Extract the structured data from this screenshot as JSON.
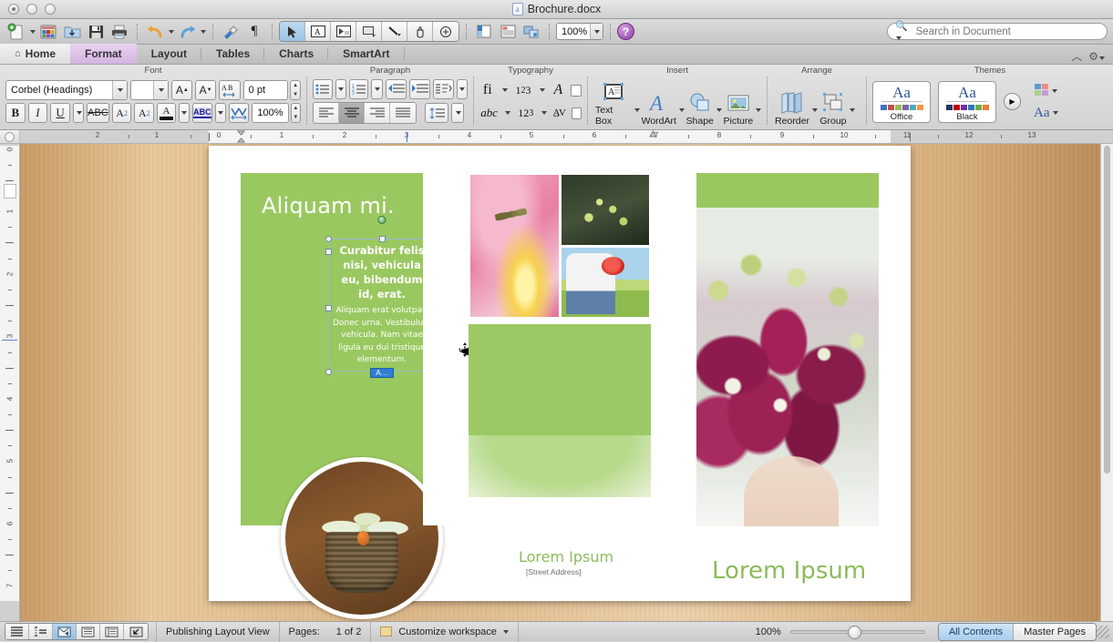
{
  "window": {
    "title": "Brochure.docx",
    "controls": [
      "close",
      "minimize",
      "zoom"
    ]
  },
  "toolbar": {
    "buttons": [
      {
        "name": "new-document",
        "icon": "new-doc-icon"
      },
      {
        "name": "open-template-gallery",
        "icon": "gallery-icon"
      },
      {
        "name": "open",
        "icon": "open-folder-icon"
      },
      {
        "name": "save",
        "icon": "floppy-icon"
      },
      {
        "name": "print",
        "icon": "printer-icon"
      },
      {
        "name": "undo",
        "icon": "undo-arrow-icon"
      },
      {
        "name": "redo",
        "icon": "redo-arrow-icon"
      },
      {
        "name": "format-painter",
        "icon": "paintbrush-icon"
      },
      {
        "name": "show-hide-marks",
        "icon": "pilcrow-icon"
      }
    ],
    "object_tools": [
      {
        "name": "select-arrow",
        "icon": "arrow-pointer-icon",
        "active": true
      },
      {
        "name": "text-box-tool",
        "icon": "textbox-icon",
        "active": false
      },
      {
        "name": "linked-text-tool",
        "icon": "linked-textbox-icon",
        "active": false
      },
      {
        "name": "shape-tool",
        "icon": "rectangle-icon",
        "active": false
      },
      {
        "name": "line-tool",
        "icon": "line-icon",
        "active": false
      },
      {
        "name": "pan-tool",
        "icon": "hand-icon",
        "active": false
      },
      {
        "name": "masking-tool",
        "icon": "mask-icon",
        "active": false
      }
    ],
    "panes": [
      {
        "name": "sidebar-pane",
        "icon": "sidebar-icon"
      },
      {
        "name": "notebook-pane",
        "icon": "notebook-icon"
      },
      {
        "name": "media-browser",
        "icon": "media-icon"
      }
    ],
    "zoom_value": "100%",
    "help_label": "?",
    "search": {
      "placeholder": "Search in Document",
      "value": "",
      "icon": "magnifier-icon"
    }
  },
  "tabs": {
    "items": [
      {
        "label": "Home",
        "icon": "home-icon",
        "active": false
      },
      {
        "label": "Format",
        "icon": "",
        "active": true
      },
      {
        "label": "Layout",
        "icon": "",
        "active": false
      },
      {
        "label": "Tables",
        "icon": "",
        "active": false
      },
      {
        "label": "Charts",
        "icon": "",
        "active": false
      },
      {
        "label": "SmartArt",
        "icon": "",
        "active": false
      }
    ],
    "collapse_icon": "chevron-up-icon",
    "settings_icon": "gear-icon"
  },
  "ribbon": {
    "groups": [
      {
        "title": "Font",
        "font_name": "Corbel (Headings)",
        "font_size": "",
        "character_spacing": "0 pt",
        "scale": "100%",
        "buttons": [
          "grow-font",
          "shrink-font",
          "character-spacing",
          "bold",
          "italic",
          "underline",
          "strikethrough",
          "superscript",
          "subscript",
          "font-color",
          "highlight",
          "horizontal-scale"
        ]
      },
      {
        "title": "Paragraph",
        "buttons": [
          "bulleted-list",
          "numbered-list",
          "decrease-indent",
          "increase-indent",
          "sort",
          "align-left",
          "align-center",
          "align-right",
          "justify",
          "line-spacing"
        ]
      },
      {
        "title": "Typography",
        "buttons": [
          "ligatures",
          "number-spacing",
          "stylistic-sets",
          "stylistic-alternates",
          "number-forms",
          "kerning"
        ]
      },
      {
        "title": "Insert",
        "items": [
          {
            "label": "Text Box",
            "icon": "textbox-icon"
          },
          {
            "label": "WordArt",
            "icon": "wordart-icon"
          },
          {
            "label": "Shape",
            "icon": "shape-icon"
          },
          {
            "label": "Picture",
            "icon": "picture-icon"
          }
        ]
      },
      {
        "title": "Arrange",
        "items": [
          {
            "label": "Reorder",
            "icon": "reorder-icon"
          },
          {
            "label": "Group",
            "icon": "group-icon"
          }
        ]
      },
      {
        "title": "Themes",
        "items": [
          {
            "label": "Office",
            "icon": "theme-thumbnail"
          },
          {
            "label": "Black",
            "icon": "theme-thumbnail"
          }
        ],
        "more_icon": "more-themes-icon",
        "colors_icon": "theme-colors-icon",
        "fonts_label": "Aa"
      }
    ]
  },
  "rulers": {
    "horizontal_labels": [
      "2",
      "1",
      "0",
      "1",
      "2",
      "3",
      "4",
      "5",
      "6",
      "7",
      "8",
      "9",
      "10",
      "11",
      "12",
      "13"
    ],
    "vertical_labels": [
      "0",
      "1",
      "2",
      "3",
      "4",
      "5",
      "6",
      "7"
    ]
  },
  "document": {
    "panel_left": {
      "heading": "Aliquam mi.",
      "selected_textbox": {
        "heading": "Curabitur felis nisi, vehicula eu, bibendum id, erat.",
        "body": "Aliquam erat volutpat. Donec urna. Vestibulum vehicula. Nam vitae ligula eu dui tristique elementum.",
        "overflow_badge": "A…",
        "handles": 8,
        "rotation_handle": true
      },
      "circle_image": "basket-of-flowers-photo"
    },
    "panel_middle": {
      "images": [
        "pink-lily-closeup-photo",
        "fern-fiddlehead-photo",
        "child-holding-red-poppy-photo"
      ],
      "footer_title": "Lorem Ipsum",
      "footer_address": "[Street Address]"
    },
    "panel_right": {
      "image": "calla-lily-bouquet-photo",
      "footer_title": "Lorem Ipsum"
    },
    "accent_green": "#9ac860",
    "footer_green": "#8cbb5b"
  },
  "statusbar": {
    "views": [
      {
        "name": "draft-view",
        "icon": "lines-icon",
        "active": false
      },
      {
        "name": "outline-view",
        "icon": "outline-icon",
        "active": false
      },
      {
        "name": "publishing-layout-view",
        "icon": "publishing-icon",
        "active": true
      },
      {
        "name": "print-layout-view",
        "icon": "page-icon",
        "active": false
      },
      {
        "name": "notebook-layout-view",
        "icon": "notebook-layout-icon",
        "active": false
      },
      {
        "name": "full-screen-view",
        "icon": "fullscreen-icon",
        "active": false
      }
    ],
    "view_label": "Publishing Layout View",
    "pages_label": "Pages:",
    "pages_value": "1 of 2",
    "workspace_label": "Customize workspace",
    "zoom_value": "100%",
    "content_tabs": [
      {
        "label": "All Contents",
        "active": true
      },
      {
        "label": "Master Pages",
        "active": false
      }
    ]
  }
}
